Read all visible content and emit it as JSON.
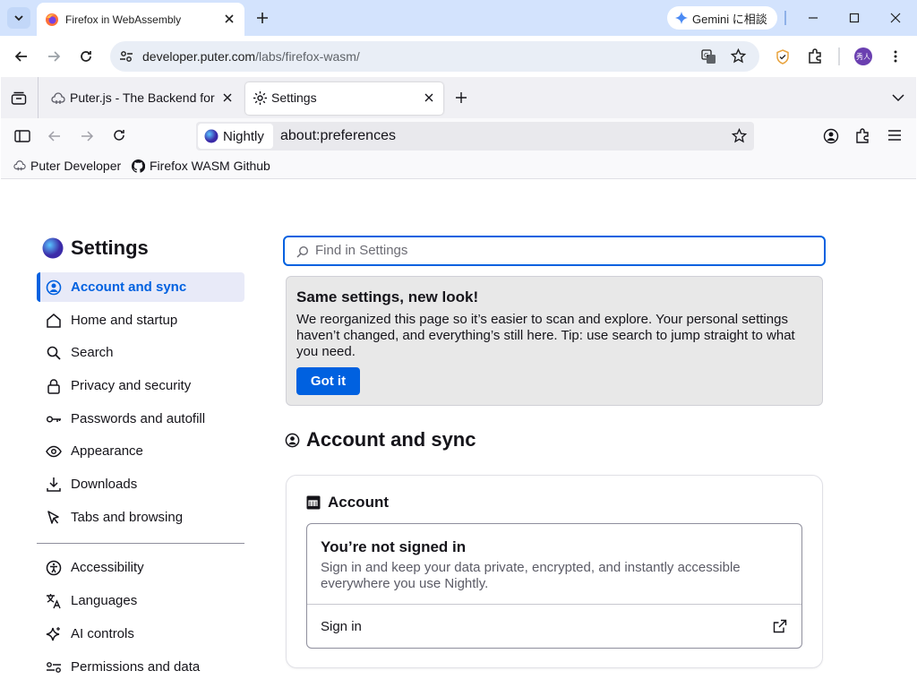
{
  "chrome": {
    "tab_title": "Firefox in WebAssembly",
    "url_host": "developer.puter.com",
    "url_path": "/labs/firefox-wasm/",
    "gemini_label": "Gemini に相談",
    "avatar_text": "秀人"
  },
  "firefox": {
    "tabs": [
      {
        "label": "Puter.js - The Backend for"
      },
      {
        "label": "Settings"
      }
    ],
    "identity_label": "Nightly",
    "url": "about:preferences",
    "bookmarks": [
      {
        "label": "Puter Developer"
      },
      {
        "label": "Firefox WASM Github"
      }
    ]
  },
  "prefs": {
    "title": "Settings",
    "search_placeholder": "Find in Settings",
    "nav": [
      {
        "label": "Account and sync",
        "icon": "account-icon"
      },
      {
        "label": "Home and startup",
        "icon": "home-icon"
      },
      {
        "label": "Search",
        "icon": "search-icon"
      },
      {
        "label": "Privacy and security",
        "icon": "lock-icon"
      },
      {
        "label": "Passwords and autofill",
        "icon": "key-icon"
      },
      {
        "label": "Appearance",
        "icon": "eye-icon"
      },
      {
        "label": "Downloads",
        "icon": "download-icon"
      },
      {
        "label": "Tabs and browsing",
        "icon": "cursor-icon"
      },
      {
        "label": "Accessibility",
        "icon": "accessibility-icon"
      },
      {
        "label": "Languages",
        "icon": "language-icon"
      },
      {
        "label": "AI controls",
        "icon": "sparkle-icon"
      },
      {
        "label": "Permissions and data",
        "icon": "permissions-icon"
      }
    ],
    "notice": {
      "title": "Same settings, new look!",
      "body": "We reorganized this page so it’s easier to scan and explore. Your personal settings haven’t changed, and everything’s still here. Tip: use search to jump straight to what you need.",
      "button": "Got it"
    },
    "section_title": "Account and sync",
    "account": {
      "title": "Account",
      "signed_out_title": "You’re not signed in",
      "signed_out_desc": "Sign in and keep your data private, encrypted, and instantly accessible everywhere you use Nightly.",
      "sign_in": "Sign in"
    }
  },
  "colors": {
    "accent": "#0061e0",
    "chrome_tabbar": "#d3e3fd"
  }
}
